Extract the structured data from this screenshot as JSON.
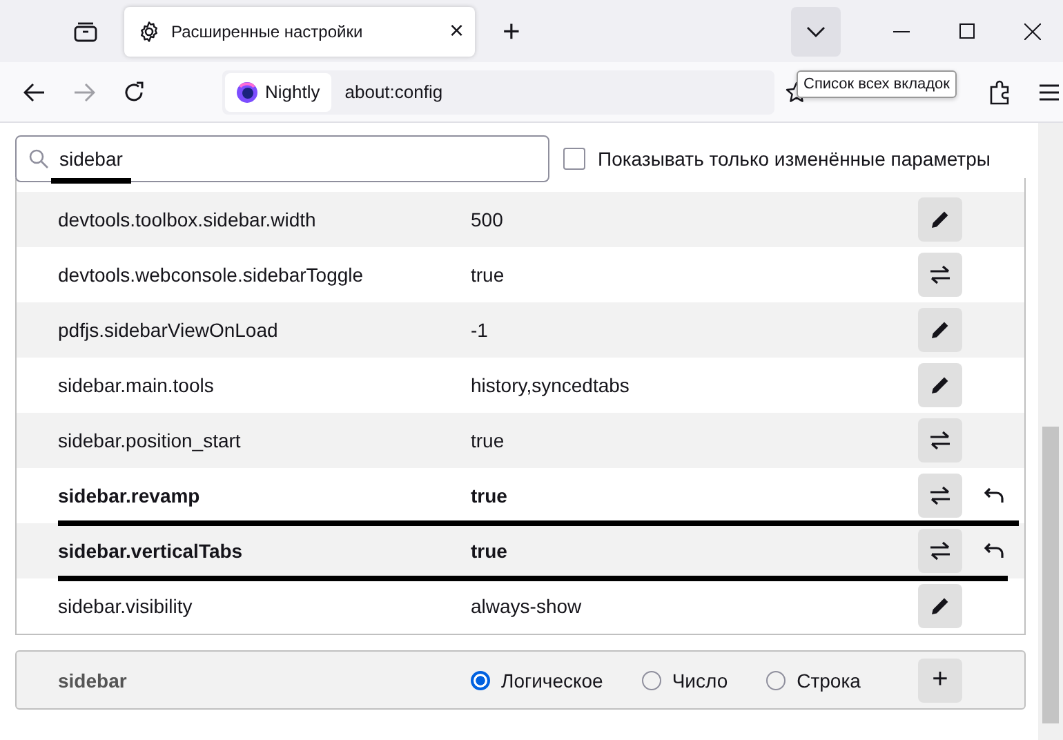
{
  "tab": {
    "title": "Расширенные настройки",
    "close": "×"
  },
  "new_tab": "+",
  "address": {
    "browser_label": "Nightly",
    "url": "about:config"
  },
  "tooltip": "Список всех вкладок",
  "search": {
    "value": "sidebar",
    "underlined": true
  },
  "modified_only": {
    "label": "Показывать только изменённые параметры",
    "checked": false
  },
  "prefs": [
    {
      "name": "devtools.toolbox.sidebar.width",
      "value": "500",
      "kind": "number",
      "modified": false,
      "underlined": false
    },
    {
      "name": "devtools.webconsole.sidebarToggle",
      "value": "true",
      "kind": "boolean",
      "modified": false,
      "underlined": false
    },
    {
      "name": "pdfjs.sidebarViewOnLoad",
      "value": "-1",
      "kind": "number",
      "modified": false,
      "underlined": false
    },
    {
      "name": "sidebar.main.tools",
      "value": "history,syncedtabs",
      "kind": "string",
      "modified": false,
      "underlined": false
    },
    {
      "name": "sidebar.position_start",
      "value": "true",
      "kind": "boolean",
      "modified": false,
      "underlined": false
    },
    {
      "name": "sidebar.revamp",
      "value": "true",
      "kind": "boolean",
      "modified": true,
      "underlined": true
    },
    {
      "name": "sidebar.verticalTabs",
      "value": "true",
      "kind": "boolean",
      "modified": true,
      "underlined": true
    },
    {
      "name": "sidebar.visibility",
      "value": "always-show",
      "kind": "string",
      "modified": false,
      "underlined": false
    }
  ],
  "new_pref": {
    "name": "sidebar",
    "types": [
      {
        "label": "Логическое",
        "selected": true
      },
      {
        "label": "Число",
        "selected": false
      },
      {
        "label": "Строка",
        "selected": false
      }
    ],
    "add": "+"
  }
}
